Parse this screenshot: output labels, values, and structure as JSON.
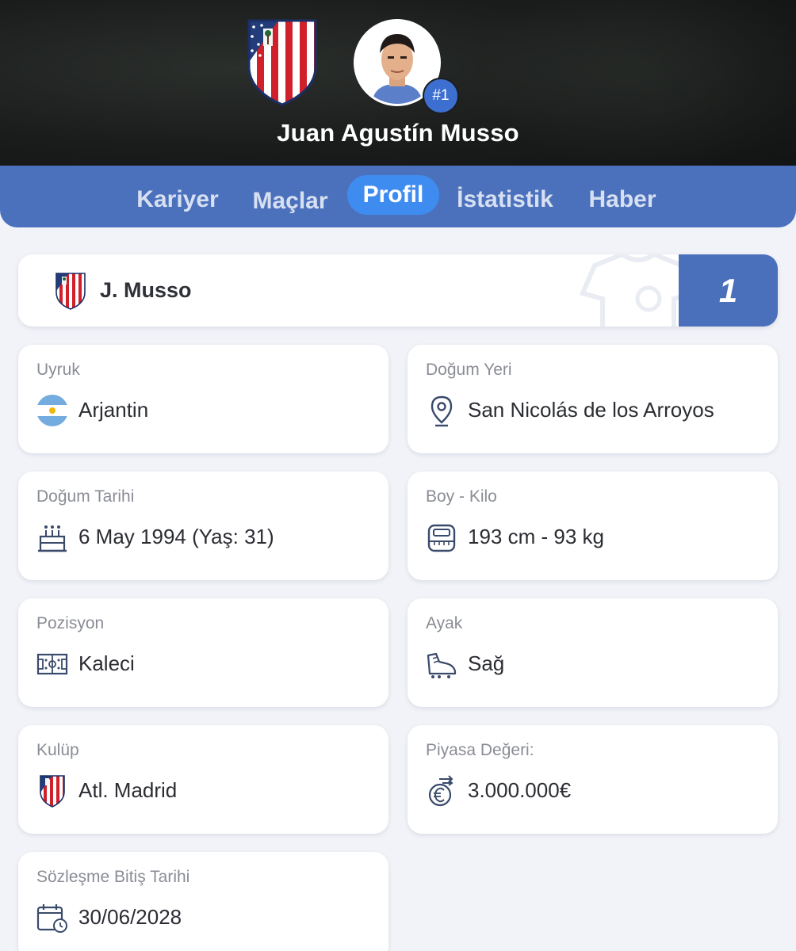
{
  "player": {
    "full_name": "Juan Agustín Musso",
    "short_name": "J. Musso",
    "jersey_badge": "#1",
    "jersey_number": "1"
  },
  "tabs": [
    {
      "label": "Kariyer",
      "active": false
    },
    {
      "label": "Maçlar",
      "active": false
    },
    {
      "label": "Profil",
      "active": true
    },
    {
      "label": "İstatistik",
      "active": false
    },
    {
      "label": "Haber",
      "active": false
    }
  ],
  "info": [
    {
      "label": "Uyruk",
      "value": "Arjantin",
      "icon": "argentina-flag-icon"
    },
    {
      "label": "Doğum Yeri",
      "value": "San Nicolás de los Arroyos",
      "icon": "location-pin-icon"
    },
    {
      "label": "Doğum Tarihi",
      "value": "6 May 1994 (Yaş: 31)",
      "icon": "birthday-cake-icon"
    },
    {
      "label": "Boy - Kilo",
      "value": "193 cm - 93 kg",
      "icon": "scale-icon"
    },
    {
      "label": "Pozisyon",
      "value": "Kaleci",
      "icon": "pitch-icon"
    },
    {
      "label": "Ayak",
      "value": "Sağ",
      "icon": "football-boot-icon"
    },
    {
      "label": "Kulüp",
      "value": "Atl. Madrid",
      "icon": "club-crest-icon"
    },
    {
      "label": "Piyasa Değeri:",
      "value": "3.000.000€",
      "icon": "euro-transfer-icon"
    },
    {
      "label": "Sözleşme Bitiş Tarihi",
      "value": "30/06/2028",
      "icon": "calendar-clock-icon"
    }
  ],
  "colors": {
    "tab_bar": "#4b71bd",
    "tab_active": "#3f8cf0",
    "number_box": "#4a6fbb",
    "page_bg": "#f1f3f8"
  }
}
